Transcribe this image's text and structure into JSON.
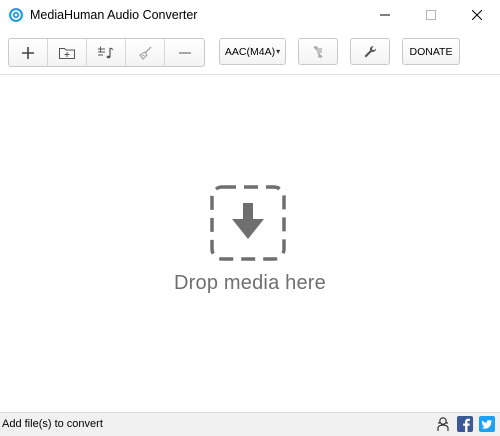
{
  "window": {
    "title": "MediaHuman Audio Converter"
  },
  "toolbar": {
    "format_label": "AAC(M4A)",
    "format_caret": "▾",
    "donate_label": "DONATE",
    "icons": [
      "add-icon",
      "add-folder-icon",
      "playlist-icon",
      "clear-list-icon",
      "remove-icon",
      "sync-itunes-icon",
      "settings-wrench-icon"
    ]
  },
  "main": {
    "drop_text": "Drop media here",
    "icon": "drop-download-icon"
  },
  "statusbar": {
    "text": "Add file(s) to convert",
    "icons": [
      "support-icon",
      "facebook-icon",
      "twitter-icon"
    ]
  },
  "colors": {
    "accent_app_icon": "#2f9fd8",
    "drop_gray": "#6f6f6f",
    "facebook": "#3b5998",
    "twitter": "#1da1f2"
  }
}
